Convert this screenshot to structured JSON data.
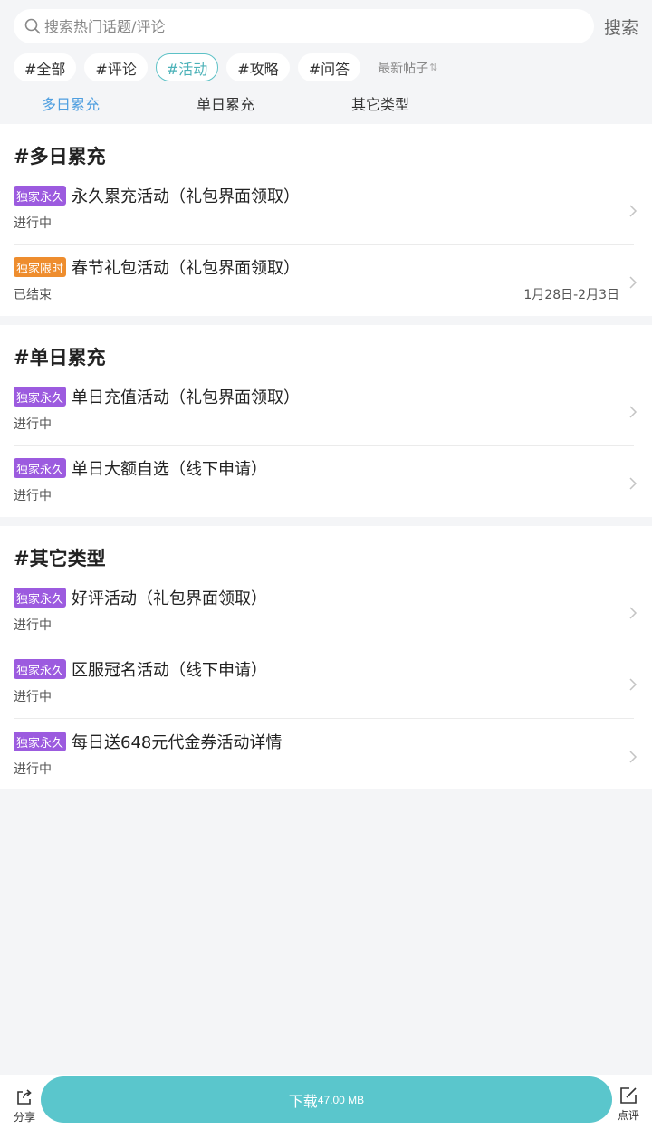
{
  "search": {
    "placeholder": "搜索热门话题/评论",
    "button": "搜索"
  },
  "chips": [
    {
      "label": "#全部",
      "active": false
    },
    {
      "label": "#评论",
      "active": false
    },
    {
      "label": "#活动",
      "active": true
    },
    {
      "label": "#攻略",
      "active": false
    },
    {
      "label": "#问答",
      "active": false
    }
  ],
  "sort": {
    "label": "最新帖子",
    "icon": "sort-arrows-icon"
  },
  "tabs": [
    {
      "label": "多日累充",
      "active": true
    },
    {
      "label": "单日累充",
      "active": false
    },
    {
      "label": "其它类型",
      "active": false
    }
  ],
  "colors": {
    "accent": "#5ac6cc",
    "tab_active": "#4f9fe0",
    "badge_permanent": "#9c5bdf",
    "badge_limited": "#ee8d2e"
  },
  "sections": [
    {
      "title": "#多日累充",
      "items": [
        {
          "badge": "独家永久",
          "badge_type": "permanent",
          "title": "永久累充活动（礼包界面领取）",
          "status": "进行中",
          "date": ""
        },
        {
          "badge": "独家限时",
          "badge_type": "limited",
          "title": "春节礼包活动（礼包界面领取）",
          "status": "已结束",
          "date": "1月28日-2月3日"
        }
      ]
    },
    {
      "title": "#单日累充",
      "items": [
        {
          "badge": "独家永久",
          "badge_type": "permanent",
          "title": "单日充值活动（礼包界面领取）",
          "status": "进行中",
          "date": ""
        },
        {
          "badge": "独家永久",
          "badge_type": "permanent",
          "title": "单日大额自选（线下申请）",
          "status": "进行中",
          "date": ""
        }
      ]
    },
    {
      "title": "#其它类型",
      "items": [
        {
          "badge": "独家永久",
          "badge_type": "permanent",
          "title": "好评活动（礼包界面领取）",
          "status": "进行中",
          "date": ""
        },
        {
          "badge": "独家永久",
          "badge_type": "permanent",
          "title": "区服冠名活动（线下申请）",
          "status": "进行中",
          "date": ""
        },
        {
          "badge": "独家永久",
          "badge_type": "permanent",
          "title": "每日送648元代金券活动详情",
          "status": "进行中",
          "date": ""
        }
      ]
    }
  ],
  "bottom": {
    "share_label": "分享",
    "download_label": "下载",
    "download_size": "47.00 MB",
    "review_label": "点评"
  }
}
